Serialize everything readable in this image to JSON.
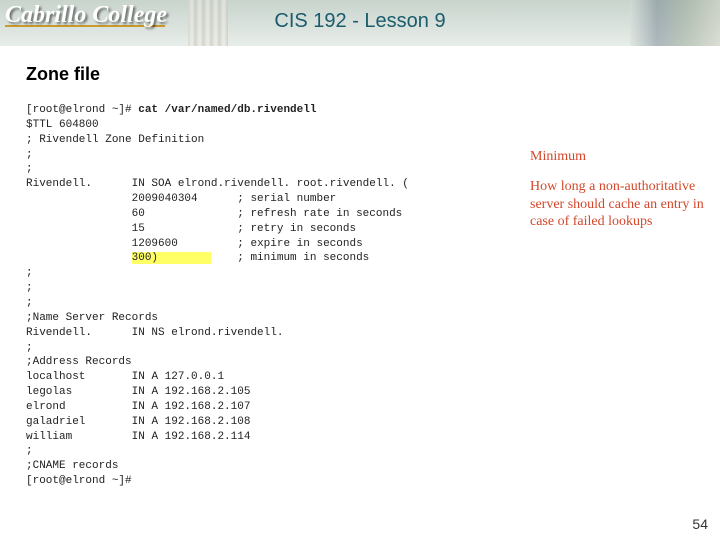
{
  "banner": {
    "logo_text": "Cabrillo College",
    "title": "CIS 192 - Lesson 9"
  },
  "slide_title": "Zone file",
  "code": {
    "prompt1": "[root@elrond ~]# ",
    "command": "cat /var/named/db.rivendell",
    "line_ttl": "$TTL 604800",
    "line_comment1": "; Rivendell Zone Definition",
    "line_sc1": ";",
    "line_sc2": ";",
    "soa_host": "Rivendell.",
    "soa_rr": "IN SOA elrond.rivendell. root.rivendell. (",
    "serial_v": "2009040304",
    "serial_c": "; serial number",
    "refresh_v": "60",
    "refresh_c": "; refresh rate in seconds",
    "retry_v": "15",
    "retry_c": "; retry in seconds",
    "expire_v": "1209600",
    "expire_c": "; expire in seconds",
    "min_v": "300)",
    "min_c": "; minimum in seconds",
    "line_sc3": ";",
    "line_sc4": ";",
    "line_sc5": ";",
    "ns_comment": ";Name Server Records",
    "ns_host": "Rivendell.",
    "ns_rr": "IN NS elrond.rivendell.",
    "line_sc6": ";",
    "addr_comment": ";Address Records",
    "a_localhost_h": "localhost",
    "a_localhost_r": "IN A 127.0.0.1",
    "a_legolas_h": "legolas",
    "a_legolas_r": "IN A 192.168.2.105",
    "a_elrond_h": "elrond",
    "a_elrond_r": "IN A 192.168.2.107",
    "a_galadriel_h": "galadriel",
    "a_galadriel_r": "IN A 192.168.2.108",
    "a_william_h": "william",
    "a_william_r": "IN A 192.168.2.114",
    "line_sc7": ";",
    "cname_comment": ";CNAME records",
    "prompt2": "[root@elrond ~]#"
  },
  "notes": {
    "minimum": "Minimum",
    "desc": "How long a non-authoritative server should cache an entry in case of failed lookups"
  },
  "page_number": "54"
}
